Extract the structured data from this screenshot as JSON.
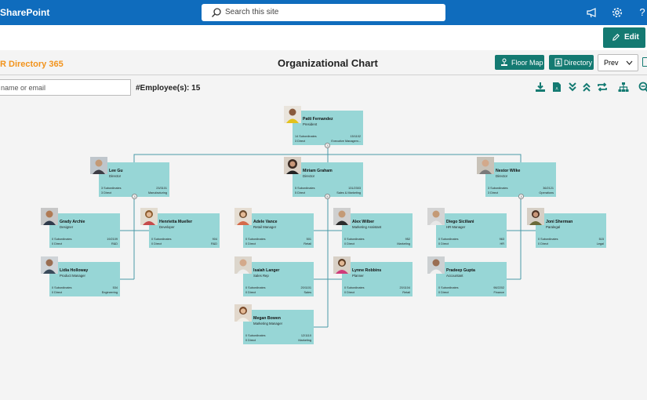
{
  "header": {
    "brand": "SharePoint",
    "search_placeholder": "Search this site",
    "icons": [
      "megaphone-icon",
      "gear-icon",
      "help-icon"
    ],
    "help_glyph": "?"
  },
  "command_bar": {
    "edit_label": "Edit"
  },
  "app": {
    "name": "R Directory 365",
    "title": "Organizational Chart",
    "floor_map_label": "Floor Map",
    "directory_label": "Directory",
    "prev_label": "Prev"
  },
  "toolbar": {
    "name_input_placeholder": "name or email",
    "employee_count": "#Employee(s): 15",
    "icons": [
      "download-icon",
      "pdf-icon",
      "expand-all-icon",
      "collapse-all-icon",
      "refresh-icon",
      "hierarchy-icon",
      "zoom-icon"
    ]
  },
  "accent_color": "#147a72",
  "brand_color": "#0f6cbd",
  "card_color": "#97d6d6",
  "employees": [
    {
      "name": "Patti Fernandez",
      "title": "President",
      "subordinates": "14 Subordinates",
      "direct": "3 Direct",
      "ext": "15/1102",
      "dept": "Executive Managem...",
      "badge": "3"
    },
    {
      "name": "Lee Gu",
      "title": "Director",
      "subordinates": "3 Subordinates",
      "direct": "3 Direct",
      "ext": "23/3101",
      "dept": "Manufacturing",
      "badge": "3"
    },
    {
      "name": "Miriam Graham",
      "title": "Director",
      "subordinates": "5 Subordinates",
      "direct": "5 Direct",
      "ext": "131/2303",
      "dept": "Sales & Marketing",
      "badge": "5"
    },
    {
      "name": "Nestor Wilke",
      "title": "Director",
      "subordinates": "3 Subordinates",
      "direct": "3 Direct",
      "ext": "36/2121",
      "dept": "Operations",
      "badge": "3"
    },
    {
      "name": "Grady Archie",
      "title": "Designer",
      "subordinates": "0 Subordinates",
      "direct": "0 Direct",
      "ext": "19/2109",
      "dept": "R&D"
    },
    {
      "name": "Henrietta Mueller",
      "title": "Developer",
      "subordinates": "0 Subordinates",
      "direct": "0 Direct",
      "ext": "904",
      "dept": "R&D"
    },
    {
      "name": "Lidia Holloway",
      "title": "Product Manager",
      "subordinates": "0 Subordinates",
      "direct": "0 Direct",
      "ext": "534",
      "dept": "Engineering"
    },
    {
      "name": "Adele Vance",
      "title": "Retail Manager",
      "subordinates": "0 Subordinates",
      "direct": "0 Direct",
      "ext": "501",
      "dept": "Retail"
    },
    {
      "name": "Alex Wilber",
      "title": "Marketing Assistant",
      "subordinates": "0 Subordinates",
      "direct": "0 Direct",
      "ext": "952",
      "dept": "Marketing"
    },
    {
      "name": "Isaiah Langer",
      "title": "Sales Rep",
      "subordinates": "0 Subordinates",
      "direct": "0 Direct",
      "ext": "20/1101",
      "dept": "Sales"
    },
    {
      "name": "Lynne Robbins",
      "title": "Planner",
      "subordinates": "0 Subordinates",
      "direct": "0 Direct",
      "ext": "20/1104",
      "dept": "Retail"
    },
    {
      "name": "Megan Bowen",
      "title": "Marketing Manager",
      "subordinates": "0 Subordinates",
      "direct": "0 Direct",
      "ext": "12/1110",
      "dept": "Marketing"
    },
    {
      "name": "Diego Siciliani",
      "title": "HR Manager",
      "subordinates": "0 Subordinates",
      "direct": "0 Direct",
      "ext": "963",
      "dept": "HR"
    },
    {
      "name": "Joni Sherman",
      "title": "Paralegal",
      "subordinates": "0 Subordinates",
      "direct": "0 Direct",
      "ext": "515",
      "dept": "Legal"
    },
    {
      "name": "Pradeep Gupta",
      "title": "Accountant",
      "subordinates": "0 Subordinates",
      "direct": "0 Direct",
      "ext": "98/2202",
      "dept": "Finance"
    }
  ]
}
